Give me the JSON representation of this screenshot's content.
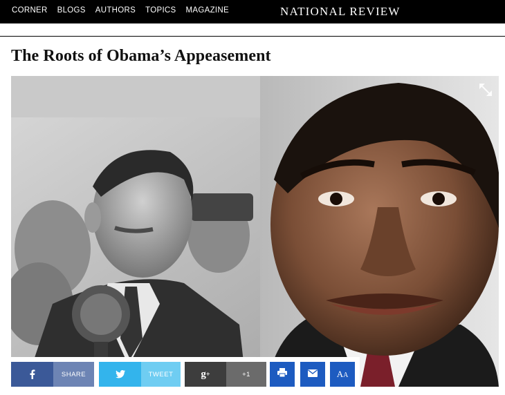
{
  "nav": {
    "items": [
      "CORNER",
      "BLOGS",
      "AUTHORS",
      "TOPICS",
      "MAGAZINE"
    ],
    "brand": "NATIONAL REVIEW"
  },
  "article": {
    "title": "The Roots of Obama’s Appeasement"
  },
  "share": {
    "facebook_label": "SHARE",
    "twitter_label": "TWEET",
    "google_label": "+1",
    "font_size_label": "AA"
  },
  "colors": {
    "facebook": "#3b5998",
    "twitter": "#33b4ec",
    "google": "#3d3d3d",
    "tool_buttons": "#1d5bc0"
  },
  "icons": [
    "facebook-icon",
    "twitter-icon",
    "google-plus-icon",
    "print-icon",
    "email-icon",
    "font-size-icon",
    "expand-icon"
  ]
}
